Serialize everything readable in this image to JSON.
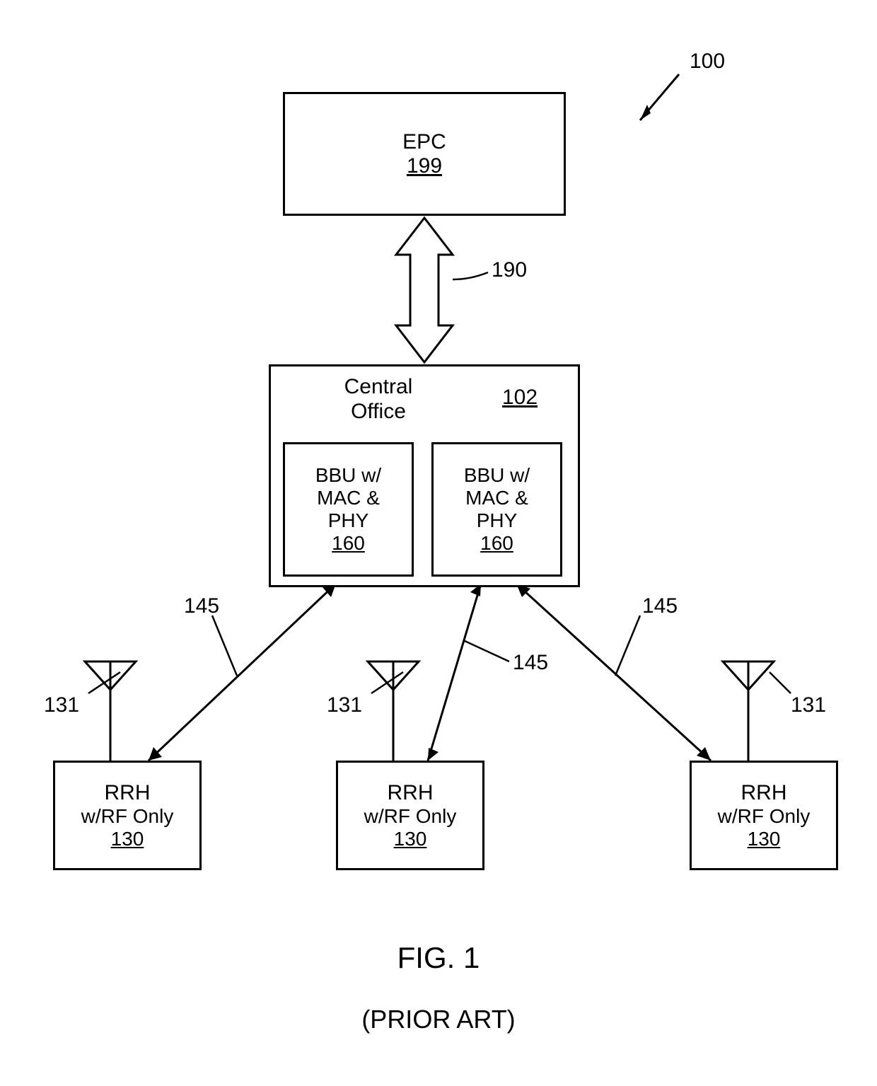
{
  "figure": {
    "number_label": "100",
    "title": "FIG. 1",
    "subtitle": "(PRIOR ART)"
  },
  "epc": {
    "label": "EPC",
    "num": "199"
  },
  "backhaul_label": "190",
  "central": {
    "label_line1": "Central",
    "label_line2": "Office",
    "num": "102",
    "bbu1": {
      "line1": "BBU w/",
      "line2": "MAC &",
      "line3": "PHY",
      "num": "160"
    },
    "bbu2": {
      "line1": "BBU w/",
      "line2": "MAC &",
      "line3": "PHY",
      "num": "160"
    }
  },
  "links": {
    "l1": "145",
    "l2": "145",
    "l3": "145"
  },
  "antennas": {
    "a1": "131",
    "a2": "131",
    "a3": "131"
  },
  "rrh": {
    "r1": {
      "line1": "RRH",
      "line2": "w/RF Only",
      "num": "130"
    },
    "r2": {
      "line1": "RRH",
      "line2": "w/RF Only",
      "num": "130"
    },
    "r3": {
      "line1": "RRH",
      "line2": "w/RF Only",
      "num": "130"
    }
  }
}
